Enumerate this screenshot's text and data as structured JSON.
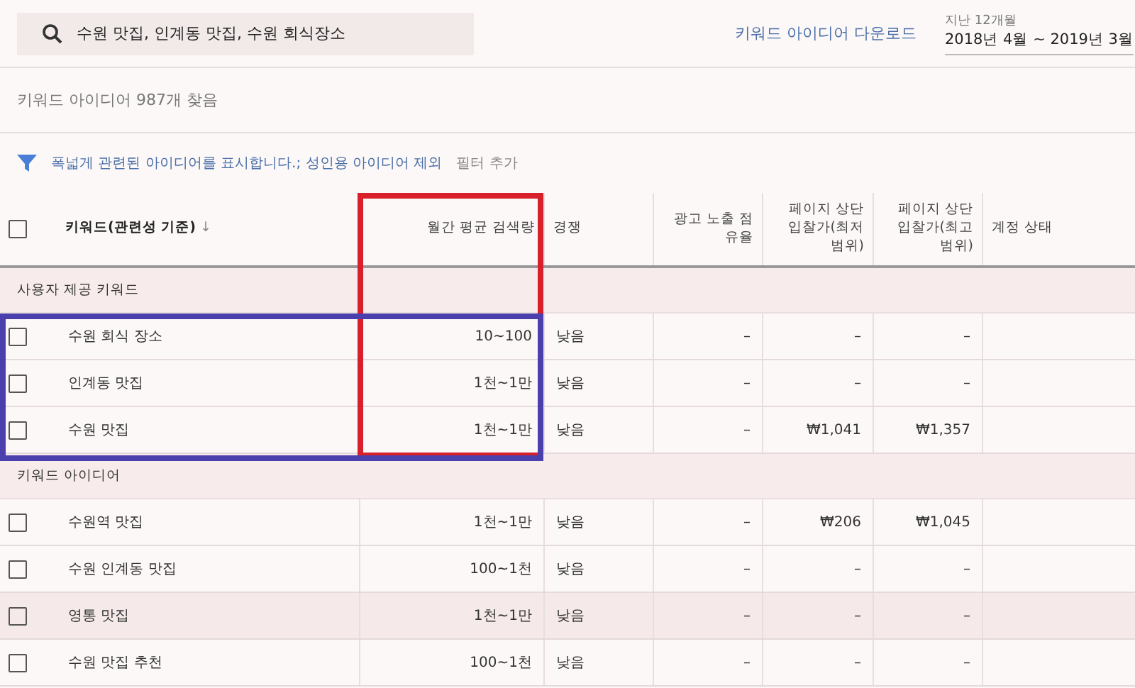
{
  "search": {
    "value": "수원 맛집, 인계동 맛집, 수원 회식장소"
  },
  "download_link": "키워드 아이디어 다운로드",
  "date_range": {
    "label": "지난 12개월",
    "value": "2018년 4월 ~ 2019년 3월"
  },
  "result_count": "키워드 아이디어 987개 찾음",
  "filter": {
    "text": "폭넓게 관련된 아이디어를 표시합니다.; 성인용 아이디어 제외",
    "add_label": "필터 추가"
  },
  "table": {
    "select_all_checked": false,
    "columns": [
      {
        "label": "키워드(관련성 기준)",
        "sort": "↓"
      },
      {
        "label": "월간 평균 검색량"
      },
      {
        "label": "경쟁"
      },
      {
        "label": "광고 노출 점유율"
      },
      {
        "label": "페이지 상단 입찰가(최저 범위)"
      },
      {
        "label": "페이지 상단 입찰가(최고 범위)"
      },
      {
        "label": "계정 상태"
      }
    ],
    "groups": [
      {
        "title": "사용자 제공 키워드",
        "rows": [
          {
            "cells": [
              "수원 회식 장소",
              "10~100",
              "낮음",
              "–",
              "–",
              "–"
            ],
            "checked": false,
            "highlighted": false
          },
          {
            "cells": [
              "인계동 맛집",
              "1천~1만",
              "낮음",
              "–",
              "–",
              "–"
            ],
            "checked": false,
            "highlighted": false
          },
          {
            "cells": [
              "수원 맛집",
              "1천~1만",
              "낮음",
              "–",
              "₩1,041",
              "₩1,357"
            ],
            "checked": false,
            "highlighted": false
          }
        ]
      },
      {
        "title": "키워드 아이디어",
        "rows": [
          {
            "cells": [
              "수원역 맛집",
              "1천~1만",
              "낮음",
              "–",
              "₩206",
              "₩1,045"
            ],
            "checked": false,
            "highlighted": false
          },
          {
            "cells": [
              "수원 인계동 맛집",
              "100~1천",
              "낮음",
              "–",
              "–",
              "–"
            ],
            "checked": false,
            "highlighted": false
          },
          {
            "cells": [
              "영통 맛집",
              "1천~1만",
              "낮음",
              "–",
              "–",
              "–"
            ],
            "checked": false,
            "highlighted": true
          },
          {
            "cells": [
              "수원 맛집 추천",
              "100~1천",
              "낮음",
              "–",
              "–",
              "–"
            ],
            "checked": false,
            "highlighted": false
          }
        ]
      }
    ]
  },
  "annotations": [
    {
      "kind": "outline",
      "color": "#d8202a"
    },
    {
      "kind": "outline",
      "color": "#4b3fae"
    }
  ]
}
